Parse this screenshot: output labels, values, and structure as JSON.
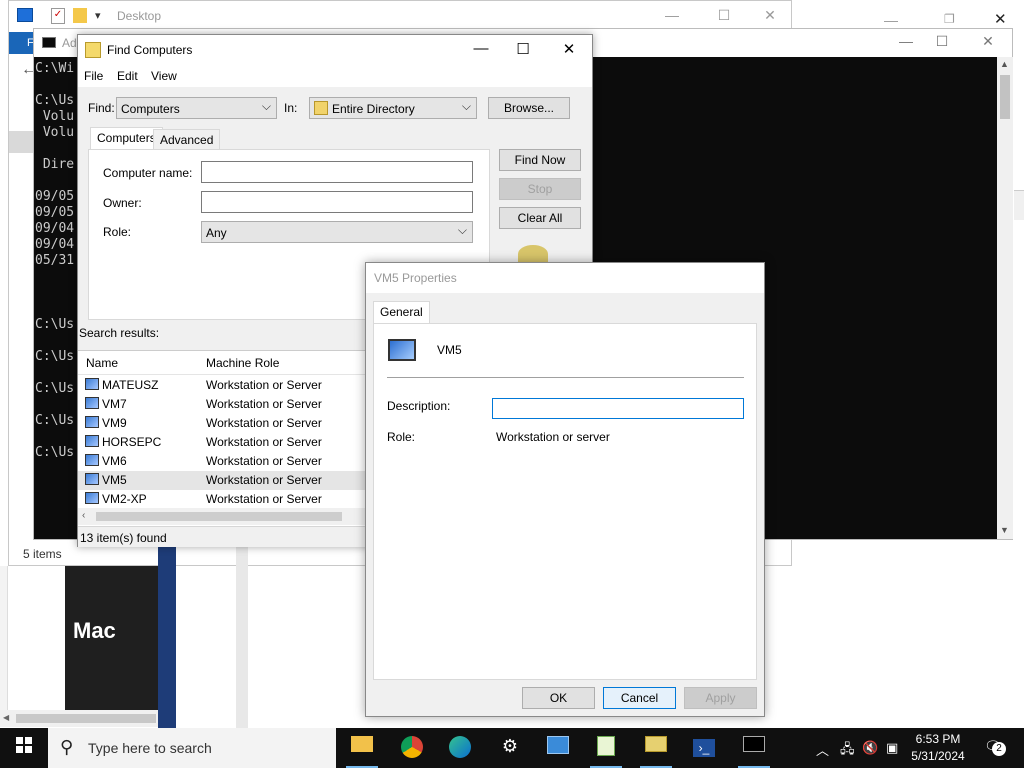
{
  "explorer": {
    "title": "Desktop",
    "ribbon_tab": "F",
    "status": "5 items"
  },
  "cmd": {
    "title": "Ad",
    "lines": [
      "C:\\Wi",
      "",
      "C:\\Us",
      " Volu",
      " Volu",
      "",
      " Dire",
      "",
      "09/05",
      "09/05",
      "09/04",
      "09/04",
      "05/31",
      "",
      "",
      "",
      "C:\\Us",
      "",
      "C:\\Us",
      "",
      "C:\\Us",
      "",
      "C:\\Us",
      "",
      "C:\\Us"
    ]
  },
  "mac_tile": "Mac",
  "find": {
    "title": "Find Computers",
    "menu": [
      "File",
      "Edit",
      "View"
    ],
    "find_label": "Find:",
    "find_value": "Computers",
    "in_label": "In:",
    "in_value": "Entire Directory",
    "browse": "Browse...",
    "tabs": [
      "Computers",
      "Advanced"
    ],
    "computer_name_label": "Computer name:",
    "owner_label": "Owner:",
    "role_label": "Role:",
    "role_value": "Any",
    "find_now": "Find Now",
    "stop": "Stop",
    "clear_all": "Clear All",
    "search_results_label": "Search results:",
    "columns": [
      "Name",
      "Machine Role"
    ],
    "rows": [
      {
        "name": "MATEUSZ",
        "role": "Workstation or Server"
      },
      {
        "name": "VM7",
        "role": "Workstation or Server"
      },
      {
        "name": "VM9",
        "role": "Workstation or Server"
      },
      {
        "name": "HORSEPC",
        "role": "Workstation or Server"
      },
      {
        "name": "VM6",
        "role": "Workstation or Server"
      },
      {
        "name": "VM5",
        "role": "Workstation or Server"
      },
      {
        "name": "VM2-XP",
        "role": "Workstation or Server"
      }
    ],
    "status": "13 item(s) found"
  },
  "props": {
    "title": "VM5 Properties",
    "tab": "General",
    "computer_name": "VM5",
    "description_label": "Description:",
    "description_value": "",
    "role_label": "Role:",
    "role_value": "Workstation or server",
    "ok": "OK",
    "cancel": "Cancel",
    "apply": "Apply"
  },
  "taskbar": {
    "search_placeholder": "Type here to search",
    "time": "6:53 PM",
    "date": "5/31/2024",
    "notification_count": "2"
  }
}
